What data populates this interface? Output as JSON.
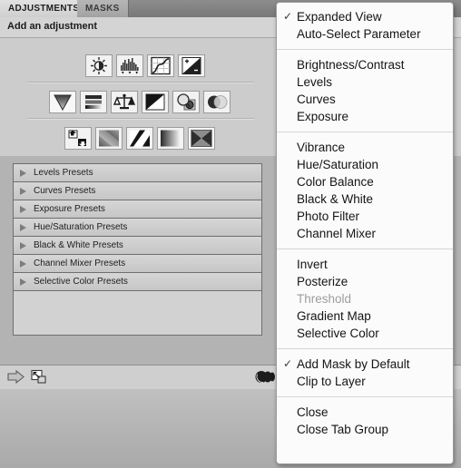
{
  "panel": {
    "tabs": [
      {
        "id": "adjustments",
        "label": "ADJUSTMENTS",
        "active": true
      },
      {
        "id": "masks",
        "label": "MASKS",
        "active": false
      }
    ],
    "menu_button_icon": "panel-menu-icon",
    "subheader": "Add an adjustment",
    "icon_rows": [
      {
        "row": 1,
        "icons": [
          {
            "name": "brightness-contrast-icon",
            "title": "Brightness/Contrast"
          },
          {
            "name": "levels-icon",
            "title": "Levels"
          },
          {
            "name": "curves-icon",
            "title": "Curves"
          },
          {
            "name": "exposure-icon",
            "title": "Exposure"
          }
        ]
      },
      {
        "row": 2,
        "icons": [
          {
            "name": "vibrance-icon",
            "title": "Vibrance"
          },
          {
            "name": "hue-saturation-icon",
            "title": "Hue/Saturation"
          },
          {
            "name": "color-balance-icon",
            "title": "Color Balance"
          },
          {
            "name": "black-and-white-icon",
            "title": "Black & White"
          },
          {
            "name": "photo-filter-icon",
            "title": "Photo Filter"
          },
          {
            "name": "channel-mixer-icon",
            "title": "Channel Mixer"
          }
        ]
      },
      {
        "row": 3,
        "icons": [
          {
            "name": "invert-icon",
            "title": "Invert"
          },
          {
            "name": "posterize-icon",
            "title": "Posterize"
          },
          {
            "name": "threshold-icon",
            "title": "Threshold"
          },
          {
            "name": "gradient-map-icon",
            "title": "Gradient Map"
          },
          {
            "name": "selective-color-icon",
            "title": "Selective Color"
          }
        ]
      }
    ],
    "presets": [
      {
        "label": "Levels Presets"
      },
      {
        "label": "Curves Presets"
      },
      {
        "label": "Exposure Presets"
      },
      {
        "label": "Hue/Saturation Presets"
      },
      {
        "label": "Black & White Presets"
      },
      {
        "label": "Channel Mixer Presets"
      },
      {
        "label": "Selective Color Presets"
      }
    ],
    "bottom_bar": [
      {
        "name": "return-to-adjustment-list-icon"
      },
      {
        "name": "clip-to-layer-icon"
      },
      {
        "name": "toggle-layer-visibility-icon"
      }
    ]
  },
  "flyout_menu": {
    "groups": [
      {
        "items": [
          {
            "label": "Expanded View",
            "checked": true,
            "disabled": false
          },
          {
            "label": "Auto-Select Parameter",
            "checked": false,
            "disabled": false
          }
        ]
      },
      {
        "items": [
          {
            "label": "Brightness/Contrast",
            "checked": false,
            "disabled": false
          },
          {
            "label": "Levels",
            "checked": false,
            "disabled": false
          },
          {
            "label": "Curves",
            "checked": false,
            "disabled": false
          },
          {
            "label": "Exposure",
            "checked": false,
            "disabled": false
          }
        ]
      },
      {
        "items": [
          {
            "label": "Vibrance",
            "checked": false,
            "disabled": false
          },
          {
            "label": "Hue/Saturation",
            "checked": false,
            "disabled": false
          },
          {
            "label": "Color Balance",
            "checked": false,
            "disabled": false
          },
          {
            "label": "Black & White",
            "checked": false,
            "disabled": false
          },
          {
            "label": "Photo Filter",
            "checked": false,
            "disabled": false
          },
          {
            "label": "Channel Mixer",
            "checked": false,
            "disabled": false
          }
        ]
      },
      {
        "items": [
          {
            "label": "Invert",
            "checked": false,
            "disabled": false
          },
          {
            "label": "Posterize",
            "checked": false,
            "disabled": false
          },
          {
            "label": "Threshold",
            "checked": false,
            "disabled": true
          },
          {
            "label": "Gradient Map",
            "checked": false,
            "disabled": false
          },
          {
            "label": "Selective Color",
            "checked": false,
            "disabled": false
          }
        ]
      },
      {
        "items": [
          {
            "label": "Add Mask by Default",
            "checked": true,
            "disabled": false
          },
          {
            "label": "Clip to Layer",
            "checked": false,
            "disabled": false
          }
        ]
      },
      {
        "items": [
          {
            "label": "Close",
            "checked": false,
            "disabled": false
          },
          {
            "label": "Close Tab Group",
            "checked": false,
            "disabled": false
          }
        ]
      }
    ],
    "check_glyph": "✓"
  },
  "colors": {
    "panel_bg": "#cccccc",
    "tab_active": "#e2e2e2",
    "tab_inactive": "#aeaeae",
    "menu_bg": "#fbfbfb",
    "text": "#141414",
    "text_disabled": "#9d9d9d",
    "border": "#6f6f6f"
  }
}
